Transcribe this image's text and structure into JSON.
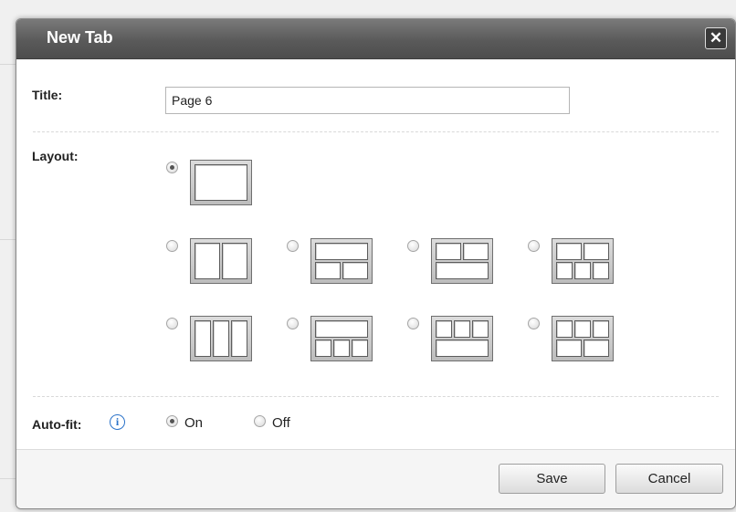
{
  "dialog": {
    "title": "New Tab",
    "close_symbol": "✕"
  },
  "form": {
    "title_label": "Title:",
    "title_value": "Page 6",
    "layout_label": "Layout:",
    "layouts": [
      {
        "name": "single",
        "selected": true
      },
      {
        "name": "two-columns",
        "selected": false
      },
      {
        "name": "top-one-bottom-two",
        "selected": false
      },
      {
        "name": "top-two-bottom-one",
        "selected": false
      },
      {
        "name": "top-two-bottom-three",
        "selected": false
      },
      {
        "name": "three-columns",
        "selected": false
      },
      {
        "name": "top-one-bottom-three",
        "selected": false
      },
      {
        "name": "top-three-bottom-one",
        "selected": false
      },
      {
        "name": "top-three-bottom-two",
        "selected": false
      }
    ],
    "autofit_label": "Auto-fit:",
    "autofit_info_symbol": "i",
    "autofit_on_label": "On",
    "autofit_off_label": "Off",
    "autofit_value": "On"
  },
  "footer": {
    "save_label": "Save",
    "cancel_label": "Cancel"
  },
  "icons": {
    "close": "close-icon",
    "info": "info-icon"
  }
}
